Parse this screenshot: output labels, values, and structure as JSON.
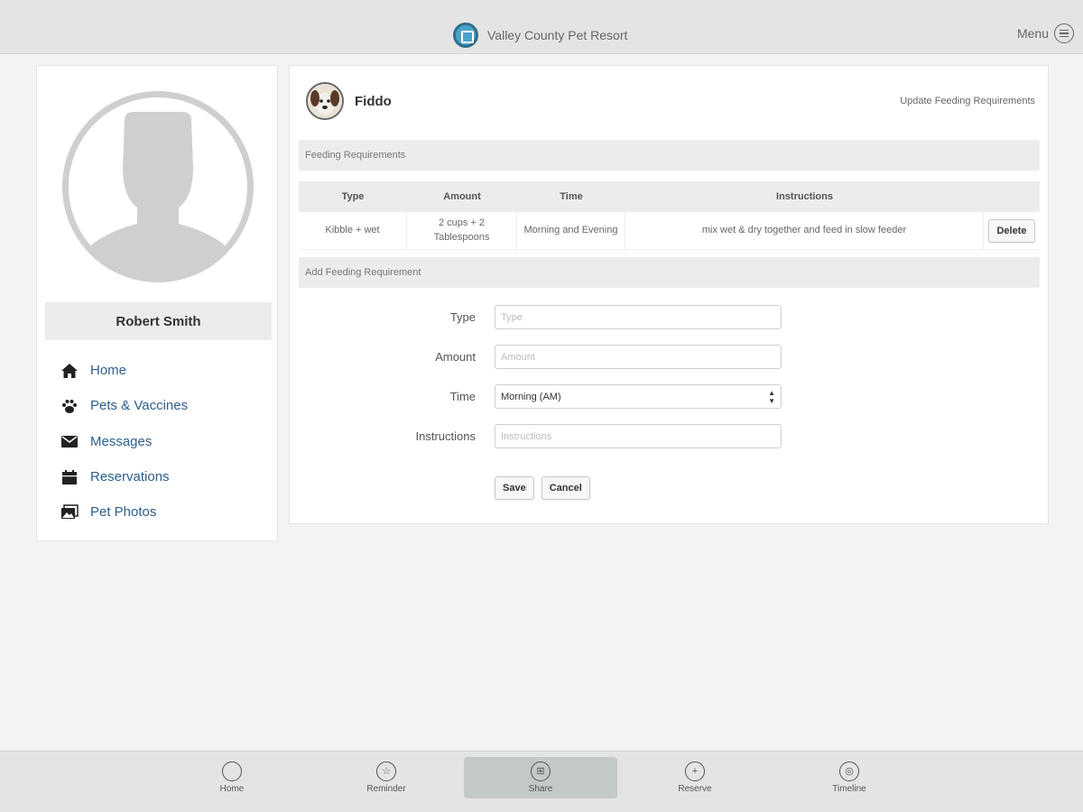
{
  "header": {
    "title": "Valley County Pet Resort",
    "menu_label": "Menu"
  },
  "user": {
    "name": "Robert Smith"
  },
  "nav": [
    {
      "label": "Home",
      "icon": "home-icon"
    },
    {
      "label": "Pets & Vaccines",
      "icon": "paw-icon"
    },
    {
      "label": "Messages",
      "icon": "envelope-icon"
    },
    {
      "label": "Reservations",
      "icon": "calendar-icon"
    },
    {
      "label": "Pet Photos",
      "icon": "photos-icon"
    }
  ],
  "pet": {
    "name": "Fiddo",
    "update_link": "Update Feeding Requirements"
  },
  "feeding": {
    "section_title": "Feeding Requirements",
    "columns": [
      "Type",
      "Amount",
      "Time",
      "Instructions"
    ],
    "rows": [
      {
        "type": "Kibble + wet",
        "amount": "2 cups + 2 Tablespoons",
        "time": "Morning and Evening",
        "instructions": "mix wet & dry together and feed in slow feeder",
        "delete_label": "Delete"
      }
    ]
  },
  "add_form": {
    "section_title": "Add Feeding Requirement",
    "type": {
      "label": "Type",
      "placeholder": "Type",
      "value": ""
    },
    "amount": {
      "label": "Amount",
      "placeholder": "Amount",
      "value": ""
    },
    "time": {
      "label": "Time",
      "selected": "Morning (AM)"
    },
    "instructions": {
      "label": "Instructions",
      "placeholder": "Instructions",
      "value": ""
    },
    "save_label": "Save",
    "cancel_label": "Cancel"
  },
  "tabs": [
    {
      "label": "Home",
      "icon": "circle-icon",
      "active": false
    },
    {
      "label": "Reminder",
      "icon": "star-icon",
      "active": false
    },
    {
      "label": "Share",
      "icon": "share-icon",
      "active": true
    },
    {
      "label": "Reserve",
      "icon": "plus-icon",
      "active": false
    },
    {
      "label": "Timeline",
      "icon": "timeline-icon",
      "active": false
    }
  ],
  "colors": {
    "nav_link": "#2d5e8c",
    "topbar": "#e4e4e4",
    "active_tab": "#c3cac6",
    "section_bar": "#ececec"
  }
}
